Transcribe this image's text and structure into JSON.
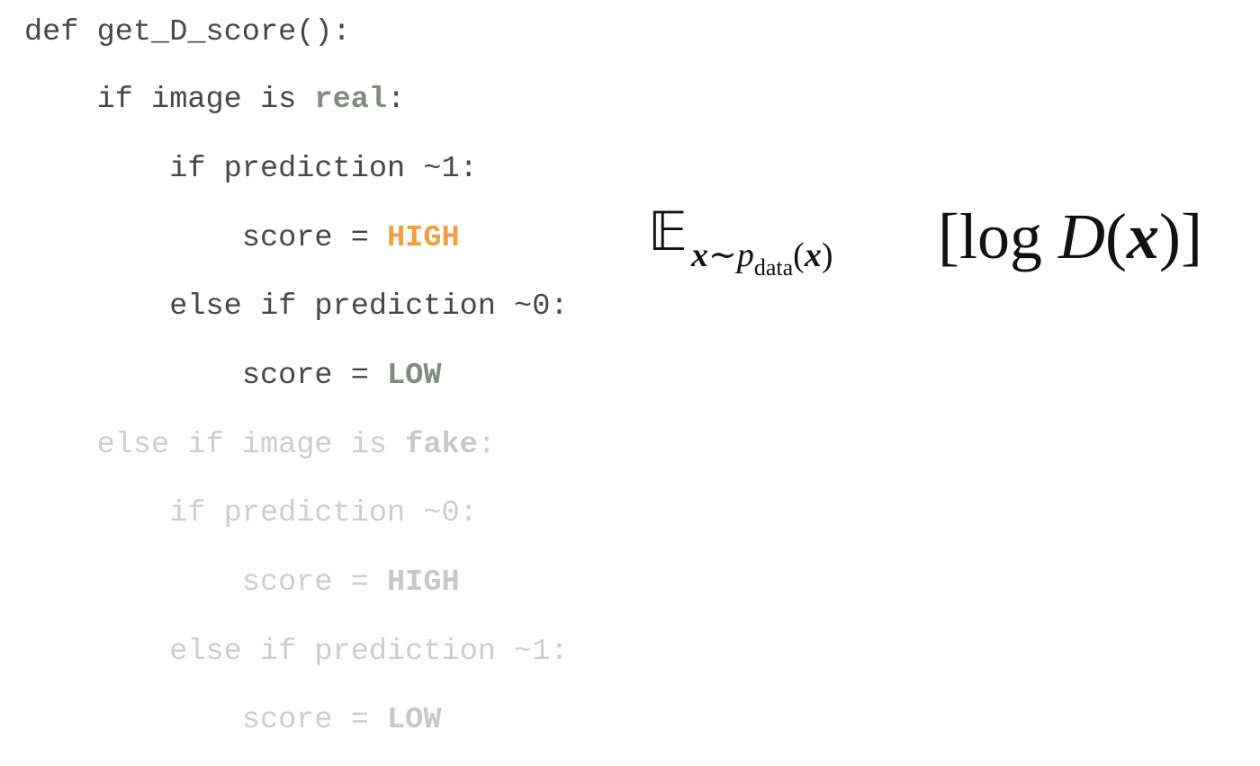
{
  "code": {
    "lines": [
      {
        "indent": "",
        "before": "def get_D_score():",
        "keyword": "",
        "after": ""
      },
      {
        "indent": "    ",
        "before": "if image is ",
        "keyword": "real",
        "after": ":"
      },
      {
        "indent": "        ",
        "before": "if prediction ~1:",
        "keyword": "",
        "after": ""
      },
      {
        "indent": "            ",
        "before": "score = ",
        "keyword": "HIGH",
        "after": ""
      },
      {
        "indent": "        ",
        "before": "else if prediction ~0:",
        "keyword": "",
        "after": ""
      },
      {
        "indent": "            ",
        "before": "score = ",
        "keyword": "LOW",
        "after": ""
      },
      {
        "indent": "    ",
        "before": "else if image is ",
        "keyword": "fake",
        "after": ":"
      },
      {
        "indent": "        ",
        "before": "if prediction ~0:",
        "keyword": "",
        "after": ""
      },
      {
        "indent": "            ",
        "before": "score = ",
        "keyword": "HIGH",
        "after": ""
      },
      {
        "indent": "        ",
        "before": "else if prediction ~1:",
        "keyword": "",
        "after": ""
      },
      {
        "indent": "            ",
        "before": "score = ",
        "keyword": "LOW",
        "after": ""
      }
    ]
  },
  "formula": {
    "expectation_symbol": "𝔼",
    "sub_var": "x",
    "sub_tilde": "∼",
    "sub_p": "p",
    "sub_data": "data",
    "sub_paren_open": "(",
    "sub_paren_var": "x",
    "sub_paren_close": ")",
    "bracket_open": "[",
    "log": "log ",
    "D": "D",
    "paren_open": "(",
    "var": "x",
    "paren_close": ")",
    "bracket_close": "]"
  },
  "colors": {
    "text": "#474747",
    "dim_text": "#cdcdcd",
    "keyword_real": "#7f8c7f",
    "keyword_high": "#f0a040"
  }
}
